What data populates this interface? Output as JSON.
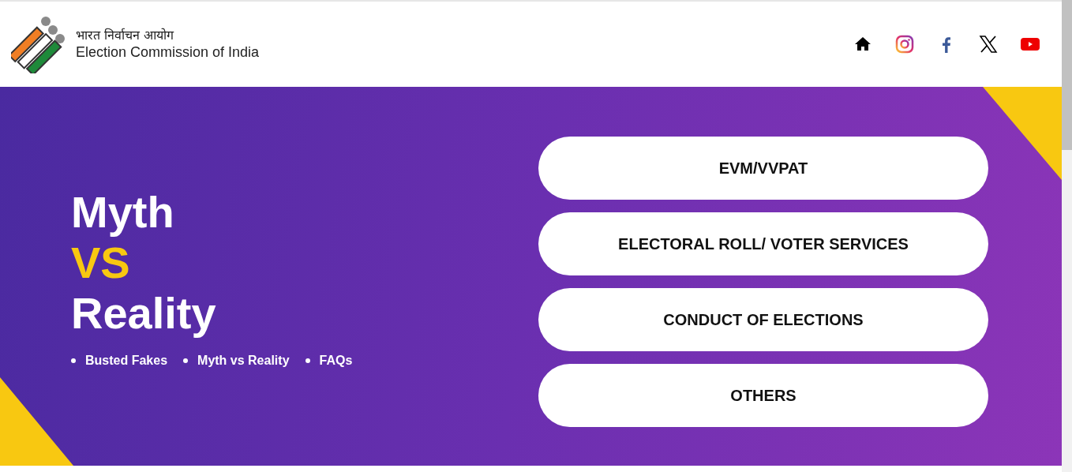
{
  "header": {
    "title_hindi": "भारत निर्वाचन आयोग",
    "title": "Election Commission of India",
    "social": [
      {
        "kind": "home"
      },
      {
        "kind": "instagram"
      },
      {
        "kind": "facebook"
      },
      {
        "kind": "x"
      },
      {
        "kind": "youtube"
      }
    ]
  },
  "hero": {
    "heading": [
      {
        "text": "Myth",
        "accent": false
      },
      {
        "text": "VS",
        "accent": true
      },
      {
        "text": "Reality",
        "accent": false
      }
    ],
    "links": [
      "Busted Fakes",
      "Myth vs Reality",
      "FAQs"
    ],
    "buttons": [
      "EVM/VVPAT",
      "ELECTORAL ROLL/ VOTER SERVICES",
      "CONDUCT OF ELECTIONS",
      "OTHERS"
    ]
  }
}
